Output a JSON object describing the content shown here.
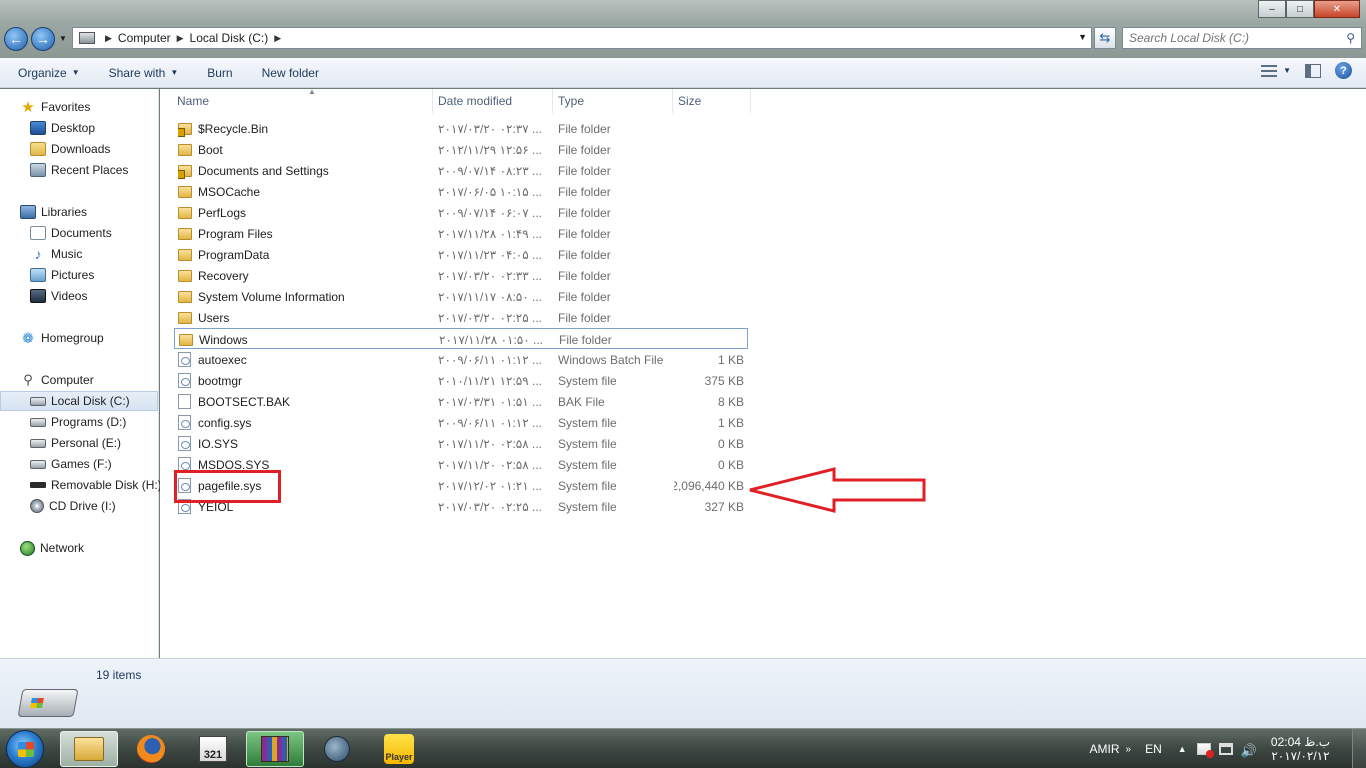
{
  "window": {
    "minimize": "–",
    "maximize": "□",
    "close": "✕"
  },
  "address": {
    "crumbs": [
      "Computer",
      "Local Disk (C:)"
    ],
    "search_placeholder": "Search Local Disk (C:)"
  },
  "toolbar": {
    "organize": "Organize",
    "share_with": "Share with",
    "burn": "Burn",
    "new_folder": "New folder"
  },
  "nav": {
    "favorites": "Favorites",
    "desktop": "Desktop",
    "downloads": "Downloads",
    "recent_places": "Recent Places",
    "libraries": "Libraries",
    "documents": "Documents",
    "music": "Music",
    "pictures": "Pictures",
    "videos": "Videos",
    "homegroup": "Homegroup",
    "computer": "Computer",
    "drives": [
      {
        "label": "Local Disk (C:)",
        "icon": "hard-disk-icon"
      },
      {
        "label": "Programs (D:)",
        "icon": "hard-disk-icon"
      },
      {
        "label": "Personal (E:)",
        "icon": "hard-disk-icon"
      },
      {
        "label": "Games (F:)",
        "icon": "hard-disk-icon"
      },
      {
        "label": "Removable Disk (H:)",
        "icon": "usb-drive-icon"
      },
      {
        "label": "CD Drive (I:)",
        "icon": "cd-drive-icon"
      }
    ],
    "network": "Network"
  },
  "columns": {
    "name": "Name",
    "date_modified": "Date modified",
    "type": "Type",
    "size": "Size"
  },
  "files": [
    {
      "name": "$Recycle.Bin",
      "date": "۲۰۱۷/۰۳/۲۰ ۰۲:۳۷ ...",
      "type": "File folder",
      "size": "",
      "icon": "locked-folder-icon"
    },
    {
      "name": "Boot",
      "date": "۲۰۱۲/۱۱/۲۹ ۱۲:۵۶ ...",
      "type": "File folder",
      "size": "",
      "icon": "folder-icon"
    },
    {
      "name": "Documents and Settings",
      "date": "۲۰۰۹/۰۷/۱۴ ۰۸:۲۳ ...",
      "type": "File folder",
      "size": "",
      "icon": "locked-folder-icon"
    },
    {
      "name": "MSOCache",
      "date": "۲۰۱۷/۰۶/۰۵ ۱۰:۱۵ ...",
      "type": "File folder",
      "size": "",
      "icon": "folder-icon"
    },
    {
      "name": "PerfLogs",
      "date": "۲۰۰۹/۰۷/۱۴ ۰۶:۰۷ ...",
      "type": "File folder",
      "size": "",
      "icon": "folder-icon"
    },
    {
      "name": "Program Files",
      "date": "۲۰۱۷/۱۱/۲۸ ۰۱:۴۹ ...",
      "type": "File folder",
      "size": "",
      "icon": "folder-icon"
    },
    {
      "name": "ProgramData",
      "date": "۲۰۱۷/۱۱/۲۳ ۰۴:۰۵ ...",
      "type": "File folder",
      "size": "",
      "icon": "folder-icon"
    },
    {
      "name": "Recovery",
      "date": "۲۰۱۷/۰۳/۲۰ ۰۲:۳۳ ...",
      "type": "File folder",
      "size": "",
      "icon": "folder-icon"
    },
    {
      "name": "System Volume Information",
      "date": "۲۰۱۷/۱۱/۱۷ ۰۸:۵۰ ...",
      "type": "File folder",
      "size": "",
      "icon": "folder-icon"
    },
    {
      "name": "Users",
      "date": "۲۰۱۷/۰۳/۲۰ ۰۲:۲۵ ...",
      "type": "File folder",
      "size": "",
      "icon": "folder-icon"
    },
    {
      "name": "Windows",
      "date": "۲۰۱۷/۱۱/۲۸ ۰۱:۵۰ ...",
      "type": "File folder",
      "size": "",
      "icon": "folder-icon"
    },
    {
      "name": "autoexec",
      "date": "۲۰۰۹/۰۶/۱۱ ۰۱:۱۲ ...",
      "type": "Windows Batch File",
      "size": "1 KB",
      "icon": "batch-file-icon"
    },
    {
      "name": "bootmgr",
      "date": "۲۰۱۰/۱۱/۲۱ ۱۲:۵۹ ...",
      "type": "System file",
      "size": "375 KB",
      "icon": "system-file-icon"
    },
    {
      "name": "BOOTSECT.BAK",
      "date": "۲۰۱۷/۰۳/۳۱ ۰۱:۵۱ ...",
      "type": "BAK File",
      "size": "8 KB",
      "icon": "file-icon"
    },
    {
      "name": "config.sys",
      "date": "۲۰۰۹/۰۶/۱۱ ۰۱:۱۲ ...",
      "type": "System file",
      "size": "1 KB",
      "icon": "system-file-icon"
    },
    {
      "name": "IO.SYS",
      "date": "۲۰۱۷/۱۱/۲۰ ۰۲:۵۸ ...",
      "type": "System file",
      "size": "0 KB",
      "icon": "system-file-icon"
    },
    {
      "name": "MSDOS.SYS",
      "date": "۲۰۱۷/۱۱/۲۰ ۰۲:۵۸ ...",
      "type": "System file",
      "size": "0 KB",
      "icon": "system-file-icon"
    },
    {
      "name": "pagefile.sys",
      "date": "۲۰۱۷/۱۲/۰۲ ۰۱:۲۱ ...",
      "type": "System file",
      "size": "2,096,440 KB",
      "icon": "system-file-icon"
    },
    {
      "name": "YEIOL",
      "date": "۲۰۱۷/۰۳/۲۰ ۰۲:۲۵ ...",
      "type": "System file",
      "size": "327 KB",
      "icon": "system-file-icon"
    }
  ],
  "status": {
    "item_count": "19 items"
  },
  "taskbar": {
    "app_321_label": "321",
    "player_label": "Player",
    "user": "AMIR",
    "chevron": "»",
    "language": "EN",
    "clock_time": "02:04 ب.ظ",
    "clock_date": "۲۰۱۷/۰۲/۱۲"
  },
  "colors": {
    "highlight": "#e01f26",
    "selection": "#d6e3f2"
  }
}
